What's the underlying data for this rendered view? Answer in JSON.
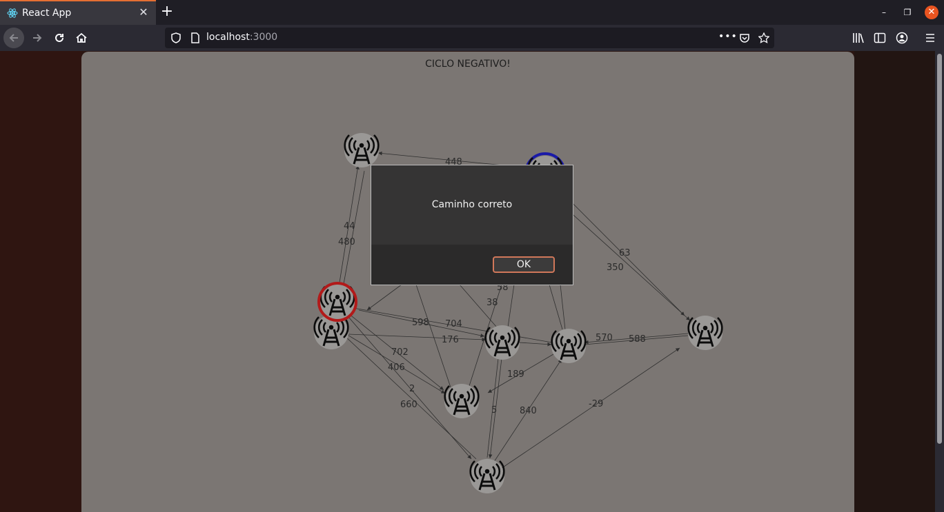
{
  "browser": {
    "tab_title": "React App",
    "url_host": "localhost",
    "url_port": ":3000",
    "accent_color": "#e56f33"
  },
  "page": {
    "status_text": "CICLO NEGATIVO!",
    "node_icon": "radio-tower-icon",
    "start_node_ring_color": "#b21a1a",
    "end_node_ring_color": "#1a1aa8",
    "edge_labels": [
      "448",
      "44",
      "480",
      "63",
      "350",
      "58",
      "38",
      "598",
      "704",
      "176",
      "570",
      "588",
      "702",
      "406",
      "2",
      "189",
      "660",
      "5",
      "840",
      "-29"
    ]
  },
  "dialog": {
    "message": "Caminho correto",
    "ok_label": "OK"
  }
}
